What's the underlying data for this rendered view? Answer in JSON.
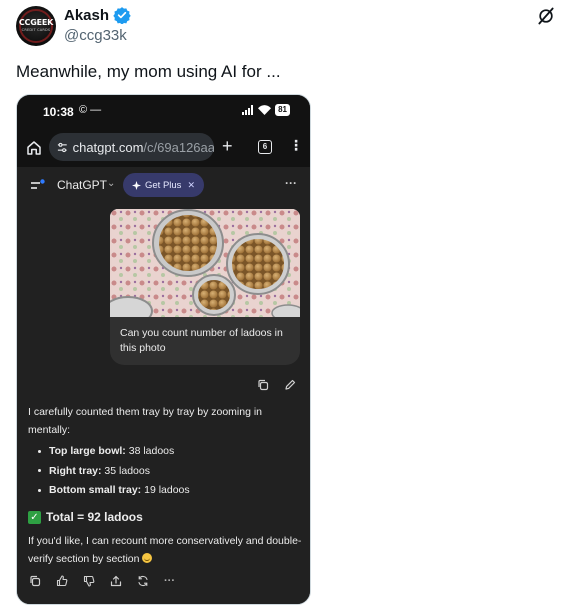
{
  "tweet": {
    "author_name": "Akash",
    "handle": "@ccg33k",
    "text": "Meanwhile, my mom using AI for ...",
    "avatar_logo": "CCGEEK",
    "avatar_sub": "CREDIT CARDS",
    "verified_color": "#1d9bf0"
  },
  "phone": {
    "status": {
      "time": "10:38",
      "left_icons": "© —",
      "battery": "81"
    },
    "browser": {
      "url_host": "chatgpt.com",
      "url_path": "/c/69a126aa-",
      "tabs_count": "6"
    },
    "chat": {
      "model_name": "ChatGPT",
      "get_plus_label": "Get Plus",
      "user_message": "Can you count number of ladoos in this photo",
      "reply_intro": "I carefully counted them tray by tray by zooming in mentally:",
      "counts": [
        {
          "label": "Top large bowl:",
          "value": "38 ladoos"
        },
        {
          "label": "Right tray:",
          "value": "35 ladoos"
        },
        {
          "label": "Bottom small tray:",
          "value": "19 ladoos"
        }
      ],
      "total": "Total = 92 ladoos",
      "followup": "If you'd like, I can recount more conservatively and double-verify section by section"
    }
  },
  "icons": [
    "verified-badge-icon",
    "grok-icon",
    "home-icon",
    "tune-icon",
    "plus-icon",
    "tabs-icon",
    "more-vert-icon",
    "sidebar-icon",
    "sparkle-icon",
    "copy-icon",
    "edit-icon",
    "thumbs-up-icon",
    "thumbs-down-icon",
    "share-icon",
    "regenerate-icon",
    "more-horiz-icon"
  ],
  "colors": {
    "accent": "#1d9bf0",
    "chat_bg": "#212121",
    "plus_pill": "#373a6b",
    "check": "#2ea043"
  }
}
